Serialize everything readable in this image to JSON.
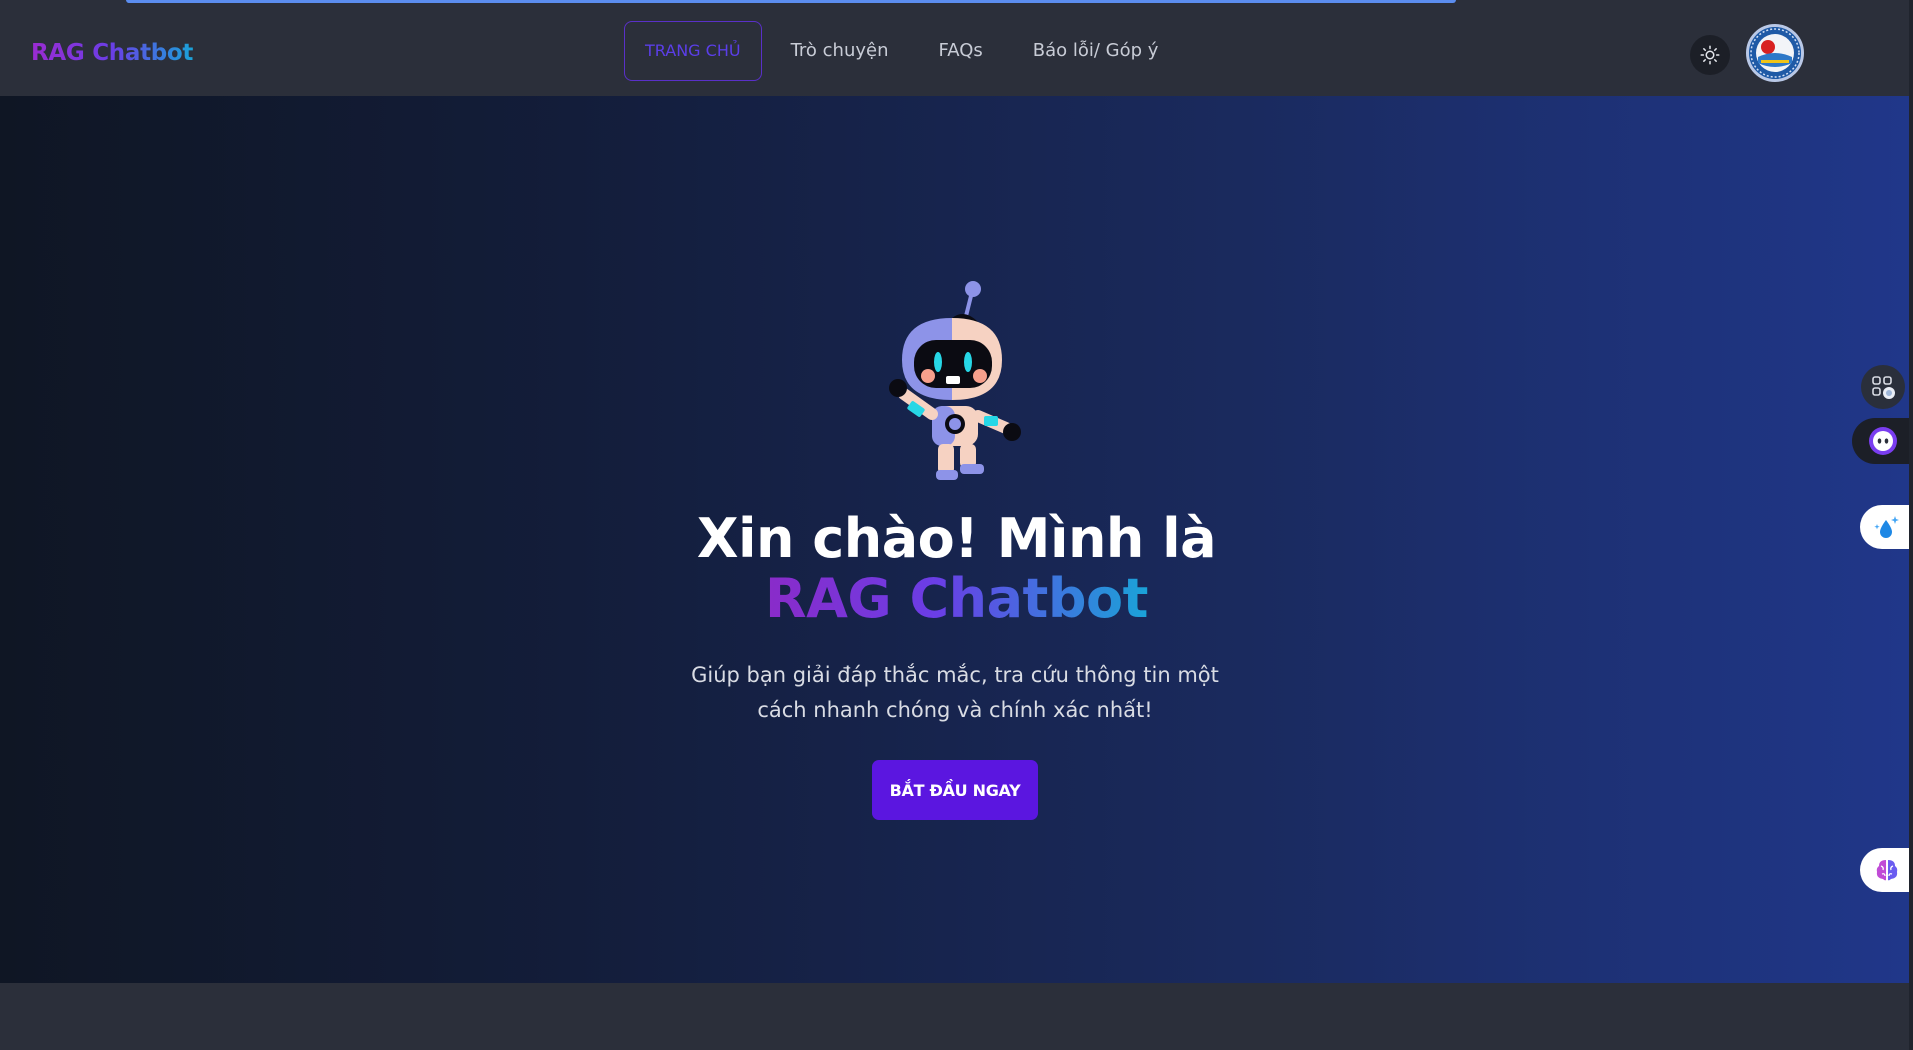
{
  "header": {
    "brand": "RAG Chatbot",
    "nav": [
      {
        "label": "TRANG CHỦ",
        "active": true
      },
      {
        "label": "Trò chuyện",
        "active": false
      },
      {
        "label": "FAQs",
        "active": false
      },
      {
        "label": "Báo lỗi/ Góp ý",
        "active": false
      }
    ],
    "theme_icon": "sun-icon",
    "avatar_icon": "organization-logo"
  },
  "hero": {
    "mascot_icon": "robot-mascot",
    "title_line1": "Xin chào! Mình là",
    "title_line2": "RAG Chatbot",
    "subtitle_line1": "Giúp bạn giải đáp thắc mắc, tra cứu thông tin một",
    "subtitle_line2": "cách nhanh chóng và chính xác nhất!",
    "cta_label": "BẮT ĐẦU NGAY"
  },
  "floating_widgets": [
    {
      "icon": "apps-grid-icon"
    },
    {
      "icon": "chatbot-face-icon"
    },
    {
      "icon": "water-sparkle-icon"
    },
    {
      "icon": "brain-icon"
    }
  ],
  "colors": {
    "cta": "#5b16e0",
    "active_nav": "#5b3ee8",
    "brand_gradient_start": "#9b2bd1",
    "brand_gradient_end": "#1aa3d8"
  }
}
